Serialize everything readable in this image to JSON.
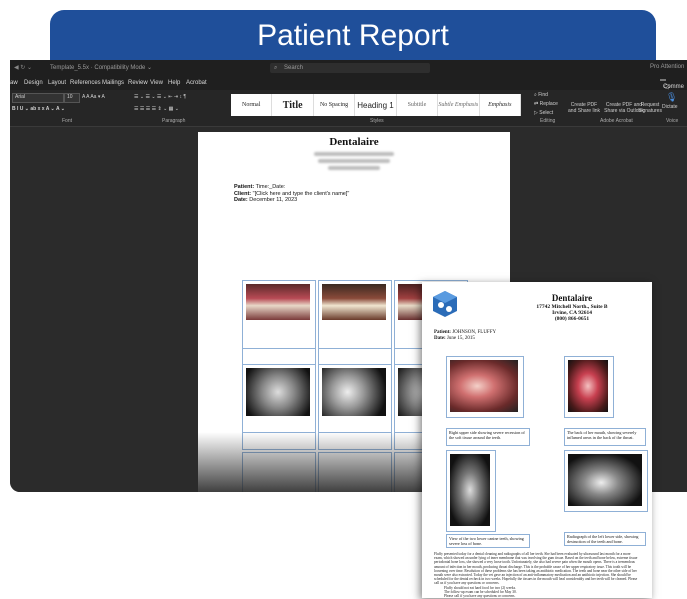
{
  "banner": {
    "title": "Patient Report"
  },
  "word": {
    "titlebar": {
      "doc": "Template_5.5x  ·  Compatibility Mode  ⌄",
      "search": "Search",
      "user": "Pro Attention"
    },
    "menu": [
      "aw",
      "Design",
      "Layout",
      "References",
      "Mailings",
      "Review",
      "View",
      "Help",
      "Acrobat"
    ],
    "comment_label": "Comme",
    "font": {
      "name": "Arial",
      "size": "10"
    },
    "group_labels": {
      "font": "Font",
      "paragraph": "Paragraph",
      "styles": "Styles",
      "editing": "Editing",
      "adobe": "Adobe Acrobat",
      "voice": "Voice"
    },
    "styles": [
      "Normal",
      "Title",
      "No Spacing",
      "Heading 1",
      "Subtitle",
      "Subtle Emphasis",
      "Emphasis"
    ],
    "editing": {
      "find": "Find",
      "replace": "Replace",
      "select": "Select"
    },
    "adobe": {
      "create": "Create PDF and Share link",
      "share": "Create PDF and Share via Outlook",
      "request": "Request Signatures"
    },
    "voice": {
      "dictate": "Dictate"
    },
    "document": {
      "title": "Dentalaire",
      "patient_label": "Patient:",
      "patient_value": "Time:_Date:",
      "client_label": "Client:",
      "client_value": "\"[Click here and type the client's name]\"",
      "date_label": "Date:",
      "date_value": "December 11, 2023"
    }
  },
  "report": {
    "clinic": "Dentalaire",
    "address1": "17742 Mitchell North., Suite B",
    "address2": "Irvine, CA 92614",
    "phone": "(800) 866-0651",
    "patient_label": "Patient:",
    "patient_value": "JOHNSON, FLUFFY",
    "date_label": "Date:",
    "date_value": "June 15, 2015",
    "captions": [
      "Right upper side showing severe recession of the soft tissue around the teeth.",
      "The back of her mouth, showing severely inflamed areas in the back of the throat.",
      "View of the two lower canine teeth, showing severe loss of bone.",
      "Radiograph of the left lower side, showing destruction of the teeth and bone."
    ],
    "summary": "Fluffy presented today for a dental cleaning and radiographs of all her teeth. She had been evaluated by ultrasound last month for a more exam, which showed an under lying of inner membrane that was involving the gum tissue. Based on the teeth and bone below, extreme tissue periodontal bone loss, she showed a very loose tooth. Unfortunately, she also had severe pain when the mouth opens. There is a tremendous amount of infection in her mouth, producing throat discharge. This is the probable cause of her upper respiratory issue. This tooth will be loosening over time. Resolution of these problems she has been taking an antibiotic medication. The teeth and bone near the other side of her mouth were also extracted. Today the vet gave an injection of an anti-inflammatory medication and an antibiotic injection. She should be scheduled for the dental recheck in two weeks. Hopefully the tissues in the mouth will heal considerably and her teeth will be cleaned. Please call us if you have any questions or concerns.",
    "list": [
      "Fluffy should not eat hard food for two (2) weeks.",
      "The follow-up exam can be scheduled for May 30.",
      "Please call if you have any questions or concerns."
    ]
  }
}
